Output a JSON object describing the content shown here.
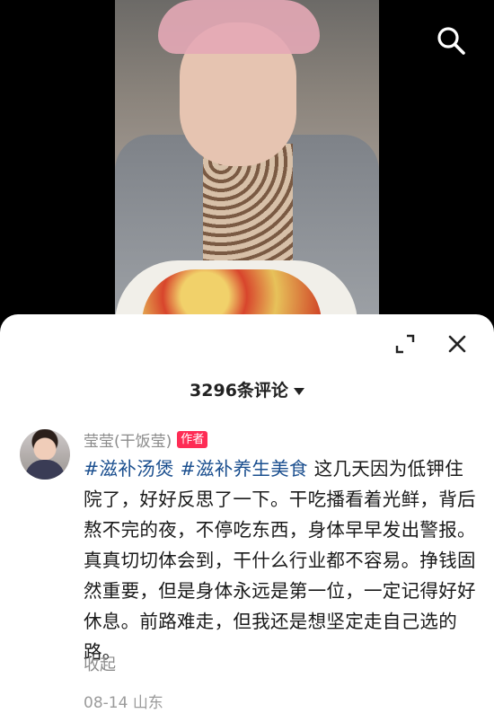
{
  "video": {
    "description_icon": "search-icon"
  },
  "sheet": {
    "comment_count_label": "3296条评论",
    "expand_icon": "expand-icon",
    "close_icon": "close-icon"
  },
  "comment": {
    "username": "莹莹(干饭莹)",
    "author_badge": "作者",
    "hashtag_1": "#滋补汤煲",
    "hashtag_2": "#滋补养生美食",
    "text": "这几天因为低钾住院了，好好反思了一下。干吃播看着光鲜，背后熬不完的夜，不停吃东西，身体早早发出警报。真真切切体会到，干什么行业都不容易。挣钱固然重要，但是身体永远是第一位，一定记得好好休息。前路难走，但我还是想坚定走自己选的路。",
    "collapse_label": "收起",
    "date": "08-14",
    "location": "山东"
  }
}
